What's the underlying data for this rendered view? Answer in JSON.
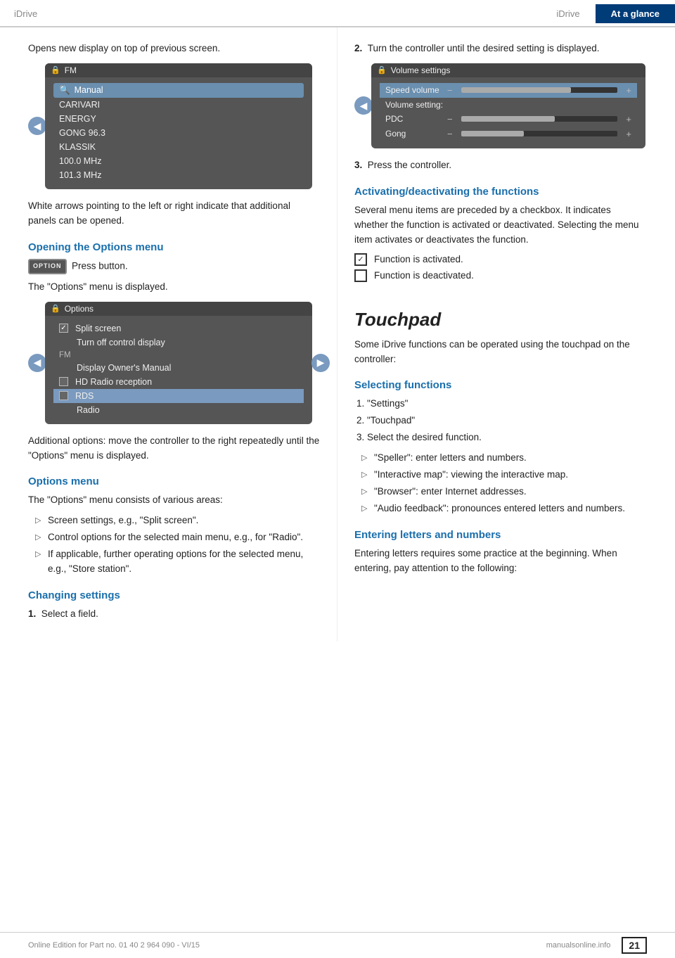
{
  "header": {
    "brand": "iDrive",
    "tab_label": "At a glance"
  },
  "left_col": {
    "intro_text": "Opens new display on top of previous screen.",
    "fm_screen": {
      "title": "FM",
      "rows": [
        {
          "label": "Manual",
          "icon": "search",
          "selected": true
        },
        {
          "label": "CARIVARI"
        },
        {
          "label": "ENERGY"
        },
        {
          "label": "GONG 96.3"
        },
        {
          "label": "KLASSIK"
        },
        {
          "label": "100.0  MHz"
        },
        {
          "label": "101.3  MHz"
        }
      ]
    },
    "white_arrows_text": "White arrows pointing to the left or right indicate that additional panels can be opened.",
    "opening_options_heading": "Opening the Options menu",
    "option_btn_label": "OPTION",
    "press_button_text": "Press button.",
    "options_displayed_text": "The \"Options\" menu is displayed.",
    "options_screen": {
      "title": "Options",
      "rows": [
        {
          "label": "Split screen",
          "checkbox": true,
          "checked": true
        },
        {
          "label": "Turn off control display",
          "checkbox": false
        },
        {
          "label": "FM",
          "section": true
        },
        {
          "label": "Display Owner's Manual",
          "checkbox": false
        },
        {
          "label": "HD Radio reception",
          "checkbox": true,
          "checked": false
        },
        {
          "label": "RDS",
          "checkbox": true,
          "checked": false,
          "highlighted": true
        },
        {
          "label": "Radio",
          "section": false
        }
      ]
    },
    "additional_options_text": "Additional options: move the controller to the right repeatedly until the \"Options\" menu is displayed.",
    "options_menu_heading": "Options menu",
    "options_menu_text": "The \"Options\" menu consists of various areas:",
    "options_menu_items": [
      "Screen settings, e.g., \"Split screen\".",
      "Control options for the selected main menu, e.g., for \"Radio\".",
      "If applicable, further operating options for the selected menu, e.g., \"Store station\"."
    ],
    "changing_settings_heading": "Changing settings",
    "step1_label": "1.",
    "step1_text": "Select a field."
  },
  "right_col": {
    "step2_label": "2.",
    "step2_text": "Turn the controller until the desired setting is displayed.",
    "volume_screen": {
      "title": "Volume settings",
      "rows": [
        {
          "label": "Speed volume",
          "type": "header",
          "selected": true
        },
        {
          "label": "Volume setting:",
          "type": "label"
        },
        {
          "label": "PDC",
          "type": "bar",
          "value": 60
        },
        {
          "label": "Gong",
          "type": "bar",
          "value": 40
        }
      ]
    },
    "step3_label": "3.",
    "step3_text": "Press the controller.",
    "activating_heading": "Activating/deactivating the functions",
    "activating_text": "Several menu items are preceded by a checkbox. It indicates whether the function is activated or deactivated. Selecting the menu item activates or deactivates the function.",
    "func_activated_label": "Function is activated.",
    "func_deactivated_label": "Function is deactivated.",
    "touchpad_heading": "Touchpad",
    "touchpad_intro": "Some iDrive functions can be operated using the touchpad on the controller:",
    "selecting_functions_heading": "Selecting functions",
    "selecting_steps": [
      "\"Settings\"",
      "\"Touchpad\"",
      "Select the desired function."
    ],
    "selecting_sub_items": [
      "\"Speller\": enter letters and numbers.",
      "\"Interactive map\": viewing the interactive map.",
      "\"Browser\": enter Internet addresses.",
      "\"Audio feedback\": pronounces entered letters and numbers."
    ],
    "entering_heading": "Entering letters and numbers",
    "entering_text": "Entering letters requires some practice at the beginning. When entering, pay attention to the following:"
  },
  "footer": {
    "citation": "Online Edition for Part no. 01 40 2 964 090 - VI/15",
    "page_number": "21",
    "source": "manualsonline.info"
  }
}
